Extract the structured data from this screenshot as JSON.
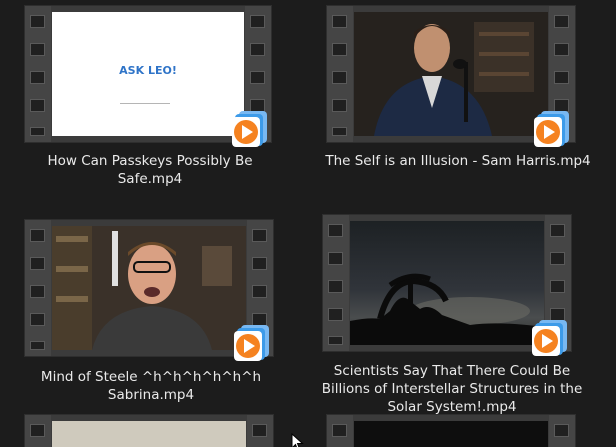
{
  "videos": [
    {
      "caption": "How Can Passkeys Possibly Be Safe.mp4",
      "thumbnail_text": "ASK LEO!"
    },
    {
      "caption": "The Self is an Illusion - Sam Harris.mp4"
    },
    {
      "caption": "Mind of Steele ^h^h^h^h^h^h Sabrina.mp4"
    },
    {
      "caption": "Scientists Say That There Could Be Billions of Interstellar Structures in the Solar System!.mp4"
    },
    {
      "caption": ""
    },
    {
      "caption": ""
    }
  ],
  "icons": {
    "play_overlay": "media-player-play-icon",
    "cursor": "mouse-cursor-icon"
  },
  "colors": {
    "background": "#1c1c1c",
    "film_frame": "#3b3b3b",
    "play_orange": "#f58220",
    "play_blue": "#3d9be9",
    "caption_text": "#eaeaea"
  }
}
